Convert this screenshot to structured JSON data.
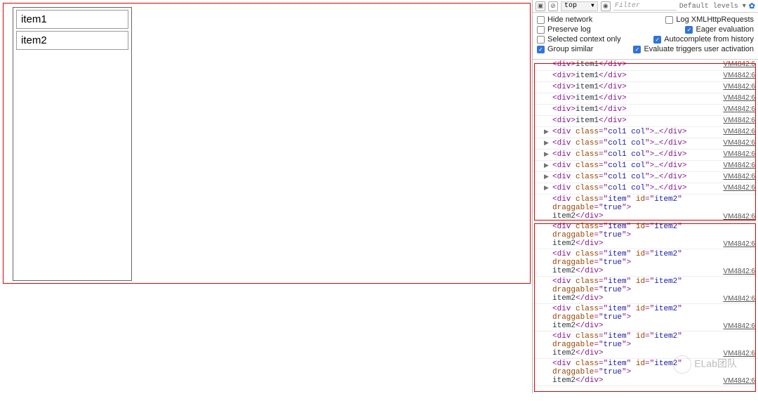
{
  "left": {
    "items": [
      "item1",
      "item2"
    ]
  },
  "toolbar": {
    "context": "top",
    "filter_placeholder": "Filter",
    "levels": "Default levels"
  },
  "settings": {
    "r1a": "Hide network",
    "r1a_on": false,
    "r1b": "Log XMLHttpRequests",
    "r1b_on": false,
    "r2a": "Preserve log",
    "r2a_on": false,
    "r2b": "Eager evaluation",
    "r2b_on": true,
    "r3a": "Selected context only",
    "r3a_on": false,
    "r3b": "Autocomplete from history",
    "r3b_on": true,
    "r4a": "Group similar",
    "r4a_on": true,
    "r4b": "Evaluate triggers user activation",
    "r4b_on": true
  },
  "log_source": "VM4842:6",
  "simple_text": "item1",
  "col_class": "col1 col",
  "item_log": {
    "class": "item",
    "id": "item2",
    "draggable": "true",
    "text": "item2"
  },
  "counts": {
    "simple": 6,
    "col": 6,
    "item": 7
  },
  "watermark": "ELab团队"
}
